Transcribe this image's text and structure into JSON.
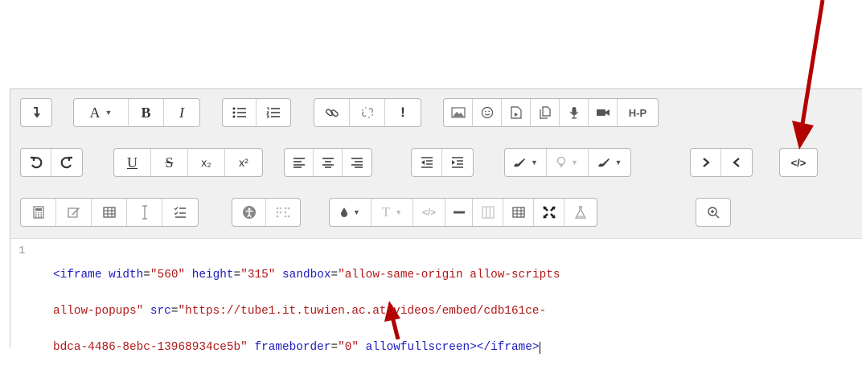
{
  "toolbar": {
    "row1": {
      "font_label": "A",
      "bold_label": "B",
      "italic_label": "I",
      "exclamation_label": "!",
      "h5p_label": "H-P"
    },
    "row2": {
      "underline_label": "U",
      "strike_label": "S",
      "subscript_label": "x₂",
      "superscript_label": "x²",
      "html_label": "</>"
    },
    "row3": {
      "text_format_label": "T",
      "code_label": "</>"
    }
  },
  "code": {
    "line_number": "1",
    "line1_parts": [
      {
        "cls": "tag",
        "t": "<iframe"
      },
      {
        "cls": "pun",
        "t": " "
      },
      {
        "cls": "attr",
        "t": "width"
      },
      {
        "cls": "pun",
        "t": "="
      },
      {
        "cls": "str",
        "t": "\"560\""
      },
      {
        "cls": "pun",
        "t": " "
      },
      {
        "cls": "attr",
        "t": "height"
      },
      {
        "cls": "pun",
        "t": "="
      },
      {
        "cls": "str",
        "t": "\"315\""
      },
      {
        "cls": "pun",
        "t": " "
      },
      {
        "cls": "attr",
        "t": "sandbox"
      },
      {
        "cls": "pun",
        "t": "="
      },
      {
        "cls": "str",
        "t": "\"allow-same-origin allow-scripts"
      }
    ],
    "line2_parts": [
      {
        "cls": "str",
        "t": "allow-popups\""
      },
      {
        "cls": "pun",
        "t": " "
      },
      {
        "cls": "attr",
        "t": "src"
      },
      {
        "cls": "pun",
        "t": "="
      },
      {
        "cls": "str",
        "t": "\"https://tube1.it.tuwien.ac.at/videos/embed/cdb161ce-"
      }
    ],
    "line3_parts": [
      {
        "cls": "str",
        "t": "bdca-4486-8ebc-13968934ce5b\""
      },
      {
        "cls": "pun",
        "t": " "
      },
      {
        "cls": "attr",
        "t": "frameborder"
      },
      {
        "cls": "pun",
        "t": "="
      },
      {
        "cls": "str",
        "t": "\"0\""
      },
      {
        "cls": "pun",
        "t": " "
      },
      {
        "cls": "attr",
        "t": "allowfullscreen"
      },
      {
        "cls": "tag",
        "t": "></iframe>"
      }
    ]
  },
  "colors": {
    "arrow": "#b30000",
    "tag": "#1c1cbf",
    "string": "#b01818"
  }
}
